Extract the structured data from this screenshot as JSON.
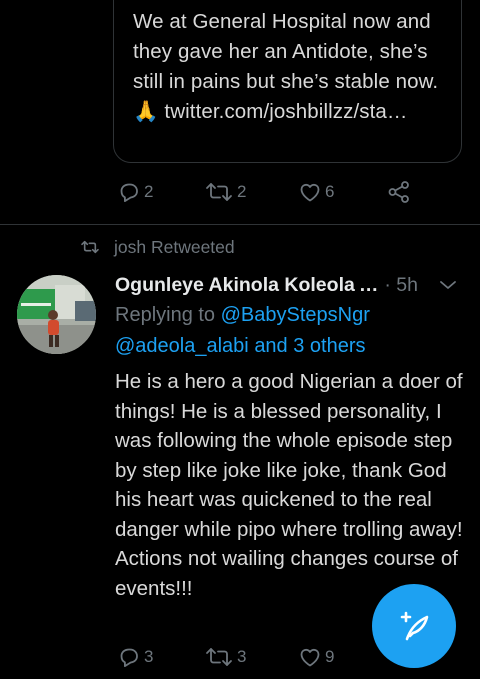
{
  "quoted_tweet": {
    "text": "We at General Hospital now and they gave her an Antidote, she’s still in pains but she’s stable now. 🙏 twitter.com/joshbillzz/sta…"
  },
  "top_actions": {
    "replies": "2",
    "retweets": "2",
    "likes": "6"
  },
  "retweet_header": {
    "label": "josh Retweeted"
  },
  "tweet": {
    "author_name": "Ogunleye Akinola Koleola",
    "ellipsis": "…",
    "meta": "· 5h",
    "replying_label": "Replying to",
    "mention_1": "@BabyStepsNgr",
    "mention_2": "@adeola_alabi",
    "and": "and",
    "others": "3 others",
    "text": "He is a hero a good Nigerian a doer of things! He is a blessed personality, I was following the whole episode step by step like joke like joke, thank God his heart was quickened to the real danger while pipo where trolling away! Actions not wailing changes course of events!!!",
    "replies": "3",
    "retweets": "3",
    "likes": "9"
  },
  "colors": {
    "background": "#000000",
    "accent": "#1da1f2",
    "muted": "#6e767d",
    "text": "#d9d9d9",
    "border": "#2f3336"
  },
  "icons": [
    "reply-icon",
    "retweet-icon",
    "like-icon",
    "share-icon",
    "caret-down-icon",
    "compose-tweet-icon"
  ]
}
